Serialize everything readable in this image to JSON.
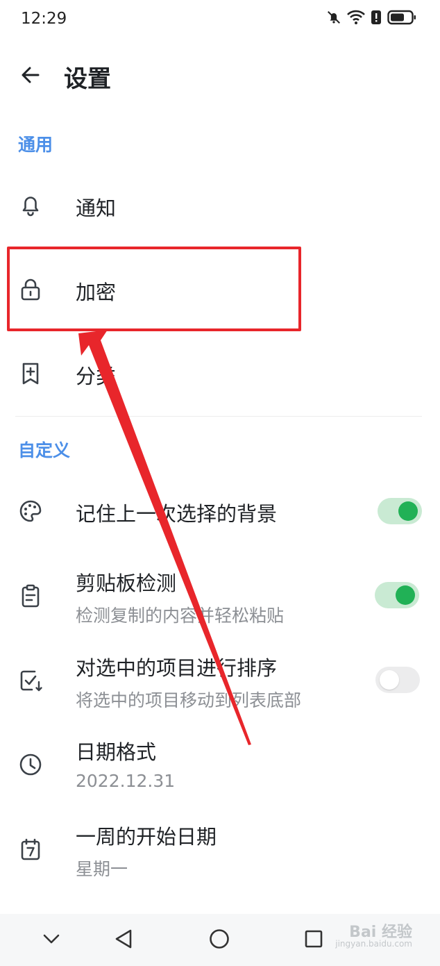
{
  "status_bar": {
    "time": "12:29",
    "icons": [
      "bell-muted-icon",
      "wifi-icon",
      "alert-icon",
      "battery-icon"
    ]
  },
  "header": {
    "title": "设置",
    "back_icon": "back-arrow-icon"
  },
  "sections": {
    "general": {
      "label": "通用",
      "items": [
        {
          "label": "通知",
          "icon": "bell-icon"
        },
        {
          "label": "加密",
          "icon": "lock-icon"
        },
        {
          "label": "分类",
          "icon": "bookmark-plus-icon"
        }
      ]
    },
    "custom": {
      "label": "自定义",
      "items": [
        {
          "label": "记住上一次选择的背景",
          "icon": "palette-icon",
          "toggle": true
        },
        {
          "label": "剪贴板检测",
          "subtitle": "检测复制的内容并轻松粘贴",
          "icon": "clipboard-icon",
          "toggle": true
        },
        {
          "label": "对选中的项目进行排序",
          "subtitle": "将选中的项目移动到列表底部",
          "icon": "checkbox-sort-icon",
          "toggle": false
        },
        {
          "label": "日期格式",
          "subtitle": "2022.12.31",
          "icon": "clock-icon"
        },
        {
          "label": "一周的开始日期",
          "subtitle": "星期一",
          "icon": "calendar-icon"
        }
      ]
    }
  },
  "nav_bar": {
    "buttons": [
      "chevron-down-icon",
      "back-triangle-icon",
      "home-circle-icon",
      "recents-square-icon"
    ]
  },
  "watermark": {
    "text": "Bai 经验",
    "sub": "jingyan.baidu.com"
  },
  "colors": {
    "accent": "#4c8fe8",
    "toggle_on": "#21b156",
    "annotation": "#e8262b"
  }
}
